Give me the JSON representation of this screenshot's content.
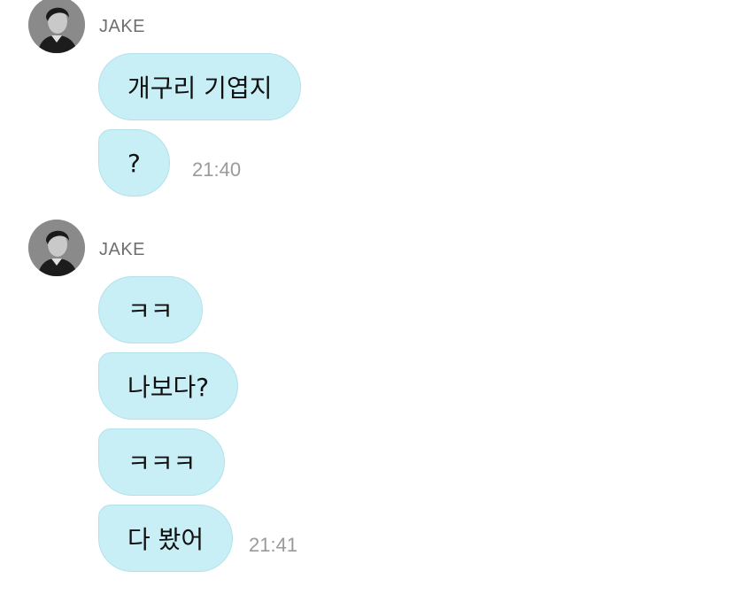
{
  "groups": [
    {
      "sender": "JAKE",
      "messages": [
        "개구리 기엽지",
        "?"
      ],
      "time": "21:40"
    },
    {
      "sender": "JAKE",
      "messages": [
        "ㅋㅋ",
        "나보다?",
        "ㅋㅋㅋ",
        "다 봤어"
      ],
      "time": "21:41"
    }
  ]
}
